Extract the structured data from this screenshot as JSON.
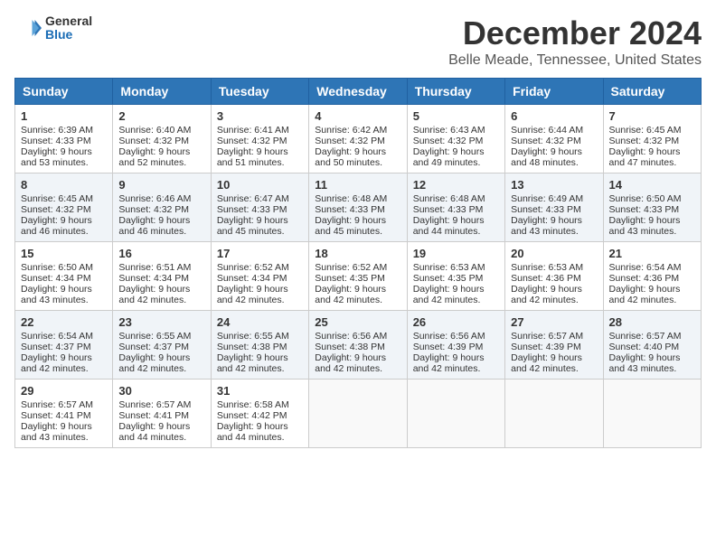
{
  "header": {
    "logo_general": "General",
    "logo_blue": "Blue",
    "title": "December 2024",
    "subtitle": "Belle Meade, Tennessee, United States"
  },
  "columns": [
    "Sunday",
    "Monday",
    "Tuesday",
    "Wednesday",
    "Thursday",
    "Friday",
    "Saturday"
  ],
  "weeks": [
    [
      {
        "day": "1",
        "sunrise": "Sunrise: 6:39 AM",
        "sunset": "Sunset: 4:33 PM",
        "daylight": "Daylight: 9 hours and 53 minutes."
      },
      {
        "day": "2",
        "sunrise": "Sunrise: 6:40 AM",
        "sunset": "Sunset: 4:32 PM",
        "daylight": "Daylight: 9 hours and 52 minutes."
      },
      {
        "day": "3",
        "sunrise": "Sunrise: 6:41 AM",
        "sunset": "Sunset: 4:32 PM",
        "daylight": "Daylight: 9 hours and 51 minutes."
      },
      {
        "day": "4",
        "sunrise": "Sunrise: 6:42 AM",
        "sunset": "Sunset: 4:32 PM",
        "daylight": "Daylight: 9 hours and 50 minutes."
      },
      {
        "day": "5",
        "sunrise": "Sunrise: 6:43 AM",
        "sunset": "Sunset: 4:32 PM",
        "daylight": "Daylight: 9 hours and 49 minutes."
      },
      {
        "day": "6",
        "sunrise": "Sunrise: 6:44 AM",
        "sunset": "Sunset: 4:32 PM",
        "daylight": "Daylight: 9 hours and 48 minutes."
      },
      {
        "day": "7",
        "sunrise": "Sunrise: 6:45 AM",
        "sunset": "Sunset: 4:32 PM",
        "daylight": "Daylight: 9 hours and 47 minutes."
      }
    ],
    [
      {
        "day": "8",
        "sunrise": "Sunrise: 6:45 AM",
        "sunset": "Sunset: 4:32 PM",
        "daylight": "Daylight: 9 hours and 46 minutes."
      },
      {
        "day": "9",
        "sunrise": "Sunrise: 6:46 AM",
        "sunset": "Sunset: 4:32 PM",
        "daylight": "Daylight: 9 hours and 46 minutes."
      },
      {
        "day": "10",
        "sunrise": "Sunrise: 6:47 AM",
        "sunset": "Sunset: 4:33 PM",
        "daylight": "Daylight: 9 hours and 45 minutes."
      },
      {
        "day": "11",
        "sunrise": "Sunrise: 6:48 AM",
        "sunset": "Sunset: 4:33 PM",
        "daylight": "Daylight: 9 hours and 45 minutes."
      },
      {
        "day": "12",
        "sunrise": "Sunrise: 6:48 AM",
        "sunset": "Sunset: 4:33 PM",
        "daylight": "Daylight: 9 hours and 44 minutes."
      },
      {
        "day": "13",
        "sunrise": "Sunrise: 6:49 AM",
        "sunset": "Sunset: 4:33 PM",
        "daylight": "Daylight: 9 hours and 43 minutes."
      },
      {
        "day": "14",
        "sunrise": "Sunrise: 6:50 AM",
        "sunset": "Sunset: 4:33 PM",
        "daylight": "Daylight: 9 hours and 43 minutes."
      }
    ],
    [
      {
        "day": "15",
        "sunrise": "Sunrise: 6:50 AM",
        "sunset": "Sunset: 4:34 PM",
        "daylight": "Daylight: 9 hours and 43 minutes."
      },
      {
        "day": "16",
        "sunrise": "Sunrise: 6:51 AM",
        "sunset": "Sunset: 4:34 PM",
        "daylight": "Daylight: 9 hours and 42 minutes."
      },
      {
        "day": "17",
        "sunrise": "Sunrise: 6:52 AM",
        "sunset": "Sunset: 4:34 PM",
        "daylight": "Daylight: 9 hours and 42 minutes."
      },
      {
        "day": "18",
        "sunrise": "Sunrise: 6:52 AM",
        "sunset": "Sunset: 4:35 PM",
        "daylight": "Daylight: 9 hours and 42 minutes."
      },
      {
        "day": "19",
        "sunrise": "Sunrise: 6:53 AM",
        "sunset": "Sunset: 4:35 PM",
        "daylight": "Daylight: 9 hours and 42 minutes."
      },
      {
        "day": "20",
        "sunrise": "Sunrise: 6:53 AM",
        "sunset": "Sunset: 4:36 PM",
        "daylight": "Daylight: 9 hours and 42 minutes."
      },
      {
        "day": "21",
        "sunrise": "Sunrise: 6:54 AM",
        "sunset": "Sunset: 4:36 PM",
        "daylight": "Daylight: 9 hours and 42 minutes."
      }
    ],
    [
      {
        "day": "22",
        "sunrise": "Sunrise: 6:54 AM",
        "sunset": "Sunset: 4:37 PM",
        "daylight": "Daylight: 9 hours and 42 minutes."
      },
      {
        "day": "23",
        "sunrise": "Sunrise: 6:55 AM",
        "sunset": "Sunset: 4:37 PM",
        "daylight": "Daylight: 9 hours and 42 minutes."
      },
      {
        "day": "24",
        "sunrise": "Sunrise: 6:55 AM",
        "sunset": "Sunset: 4:38 PM",
        "daylight": "Daylight: 9 hours and 42 minutes."
      },
      {
        "day": "25",
        "sunrise": "Sunrise: 6:56 AM",
        "sunset": "Sunset: 4:38 PM",
        "daylight": "Daylight: 9 hours and 42 minutes."
      },
      {
        "day": "26",
        "sunrise": "Sunrise: 6:56 AM",
        "sunset": "Sunset: 4:39 PM",
        "daylight": "Daylight: 9 hours and 42 minutes."
      },
      {
        "day": "27",
        "sunrise": "Sunrise: 6:57 AM",
        "sunset": "Sunset: 4:39 PM",
        "daylight": "Daylight: 9 hours and 42 minutes."
      },
      {
        "day": "28",
        "sunrise": "Sunrise: 6:57 AM",
        "sunset": "Sunset: 4:40 PM",
        "daylight": "Daylight: 9 hours and 43 minutes."
      }
    ],
    [
      {
        "day": "29",
        "sunrise": "Sunrise: 6:57 AM",
        "sunset": "Sunset: 4:41 PM",
        "daylight": "Daylight: 9 hours and 43 minutes."
      },
      {
        "day": "30",
        "sunrise": "Sunrise: 6:57 AM",
        "sunset": "Sunset: 4:41 PM",
        "daylight": "Daylight: 9 hours and 44 minutes."
      },
      {
        "day": "31",
        "sunrise": "Sunrise: 6:58 AM",
        "sunset": "Sunset: 4:42 PM",
        "daylight": "Daylight: 9 hours and 44 minutes."
      },
      null,
      null,
      null,
      null
    ]
  ]
}
